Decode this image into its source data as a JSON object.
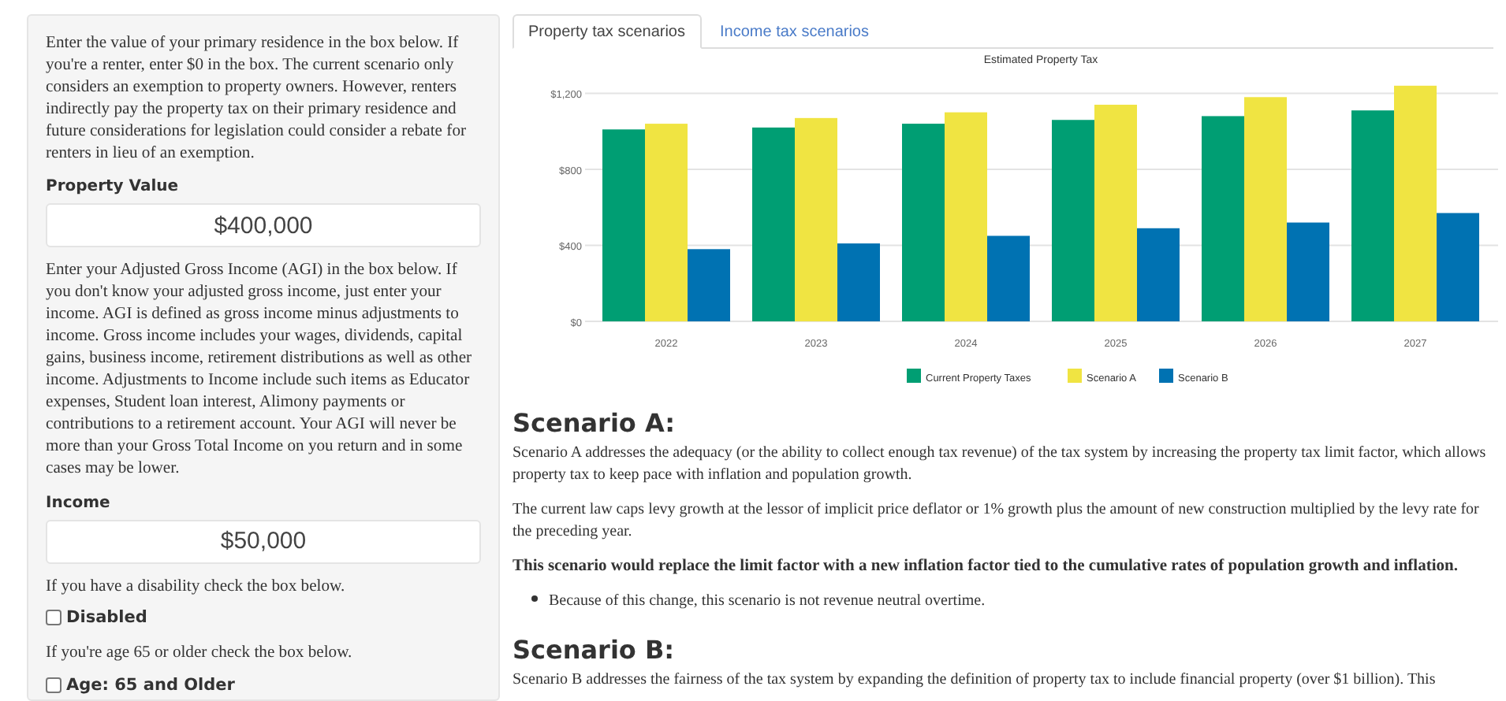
{
  "sidebar": {
    "items": [
      {
        "kind": "text",
        "text": "Enter the value of your primary residence in the box below. If you're a renter, enter $0 in the box. The current scenario only considers an exemption to property owners. However, renters indirectly pay the property tax on their primary residence and future considerations for legislation could consider a rebate for renters in lieu of an exemption."
      },
      {
        "kind": "field",
        "label": "Property Value",
        "value": "$400,000"
      },
      {
        "kind": "text",
        "text": "Enter your Adjusted Gross Income (AGI) in the box below. If you don't know your adjusted gross income, just enter your income. AGI is defined as gross income minus adjustments to income. Gross income includes your wages, dividends, capital gains, business income, retirement distributions as well as other income. Adjustments to Income include such items as Educator expenses, Student loan interest, Alimony payments or contributions to a retirement account. Your AGI will never be more than your Gross Total Income on you return and in some cases may be lower."
      },
      {
        "kind": "field",
        "label": "Income",
        "value": "$50,000"
      },
      {
        "kind": "text",
        "text": "If you have a disability check the box below."
      },
      {
        "kind": "checkbox",
        "label": "Disabled",
        "checked": false
      },
      {
        "kind": "text",
        "text": "If you're age 65 or older check the box below."
      },
      {
        "kind": "checkbox",
        "label": "Age: 65 and Older",
        "checked": false
      }
    ]
  },
  "tabs": [
    {
      "label": "Property tax scenarios",
      "selected": true
    },
    {
      "label": "Income tax scenarios",
      "selected": false
    }
  ],
  "chart_data": {
    "type": "bar",
    "title": "Estimated Property Tax",
    "categories": [
      "2022",
      "2023",
      "2024",
      "2025",
      "2026",
      "2027"
    ],
    "series": [
      {
        "name": "Current Property Taxes",
        "color": "#009e73",
        "values": [
          1010,
          1020,
          1040,
          1060,
          1080,
          1110
        ]
      },
      {
        "name": "Scenario A",
        "color": "#f0e442",
        "values": [
          1040,
          1070,
          1100,
          1140,
          1180,
          1240
        ]
      },
      {
        "name": "Scenario B",
        "color": "#0072b2",
        "values": [
          380,
          410,
          450,
          490,
          520,
          570
        ]
      }
    ],
    "legend": "bottom",
    "grid": true,
    "ylim": [
      0,
      1260
    ],
    "yticks": [
      {
        "value": 0,
        "label": "$0"
      },
      {
        "value": 400,
        "label": "$400"
      },
      {
        "value": 800,
        "label": "$800"
      },
      {
        "value": 1200,
        "label": "$1,200"
      }
    ]
  },
  "sections": [
    {
      "heading": "Scenario A:",
      "blocks": [
        {
          "kind": "paragraph",
          "text": "Scenario A addresses the adequacy (or the ability to collect enough tax revenue) of the tax system by increasing the property tax limit factor, which allows property tax to keep pace with inflation and population growth."
        },
        {
          "kind": "paragraph",
          "text": "The current law caps levy growth at the lessor of implicit price deflator or 1% growth plus the amount of new construction multiplied by the levy rate for the preceding year."
        },
        {
          "kind": "bold",
          "text": "This scenario would replace the limit factor with a new inflation factor tied to the cumulative rates of population growth and inflation."
        },
        {
          "kind": "bullet",
          "text": "Because of this change, this scenario is not revenue neutral overtime."
        }
      ]
    },
    {
      "heading": "Scenario B:",
      "blocks": [
        {
          "kind": "paragraph",
          "text": "Scenario B addresses the fairness of the tax system by expanding the definition of property tax to include financial property (over $1 billion). This"
        }
      ]
    }
  ]
}
